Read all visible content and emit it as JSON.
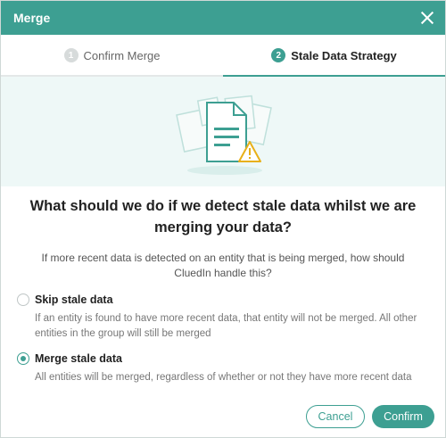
{
  "dialog": {
    "title": "Merge"
  },
  "steps": [
    {
      "number": "1",
      "label": "Confirm Merge"
    },
    {
      "number": "2",
      "label": "Stale Data Strategy"
    }
  ],
  "question": "What should we do if we detect stale data whilst we are merging your data?",
  "subtitle": "If more recent data is detected on an entity that is being merged, how should CluedIn handle this?",
  "options": [
    {
      "label": "Skip stale data",
      "description": "If an entity is found to have more recent data, that entity will not be merged. All other entities in the group will still be merged",
      "selected": false
    },
    {
      "label": "Merge stale data",
      "description": "All entities will be merged, regardless of whether or not they have more recent data",
      "selected": true
    }
  ],
  "footer": {
    "cancel_label": "Cancel",
    "confirm_label": "Confirm"
  },
  "colors": {
    "accent": "#3d9f92",
    "hero_bg": "#eef8f7",
    "warning": "#e8b019"
  },
  "icons": {
    "close": "close-icon",
    "hero": "stale-document-warning-illustration"
  }
}
